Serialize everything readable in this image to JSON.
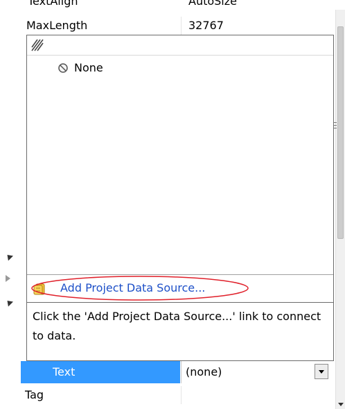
{
  "property_grid": {
    "top_partial": {
      "name": "TextAlign",
      "value": "AutoSize"
    },
    "rows": {
      "max_length": {
        "name": "MaxLength",
        "value": "32767"
      },
      "text": {
        "name": "Text",
        "value": "(none)"
      },
      "tag": {
        "name": "Tag",
        "value": ""
      }
    }
  },
  "data_source_picker": {
    "toolbar_icon": "hatched-lines-icon",
    "items": [
      {
        "label": "None",
        "icon": "prohibited-icon"
      }
    ],
    "add_link": {
      "label": "Add Project Data Source...",
      "icon": "database-icon",
      "highlight_color": "#e0202a"
    },
    "help_text": "Click the 'Add Project Data Source...' link to connect to data."
  },
  "colors": {
    "selection": "#3399ff",
    "link": "#1e50c8",
    "panel_border": "#6b6b6b"
  }
}
